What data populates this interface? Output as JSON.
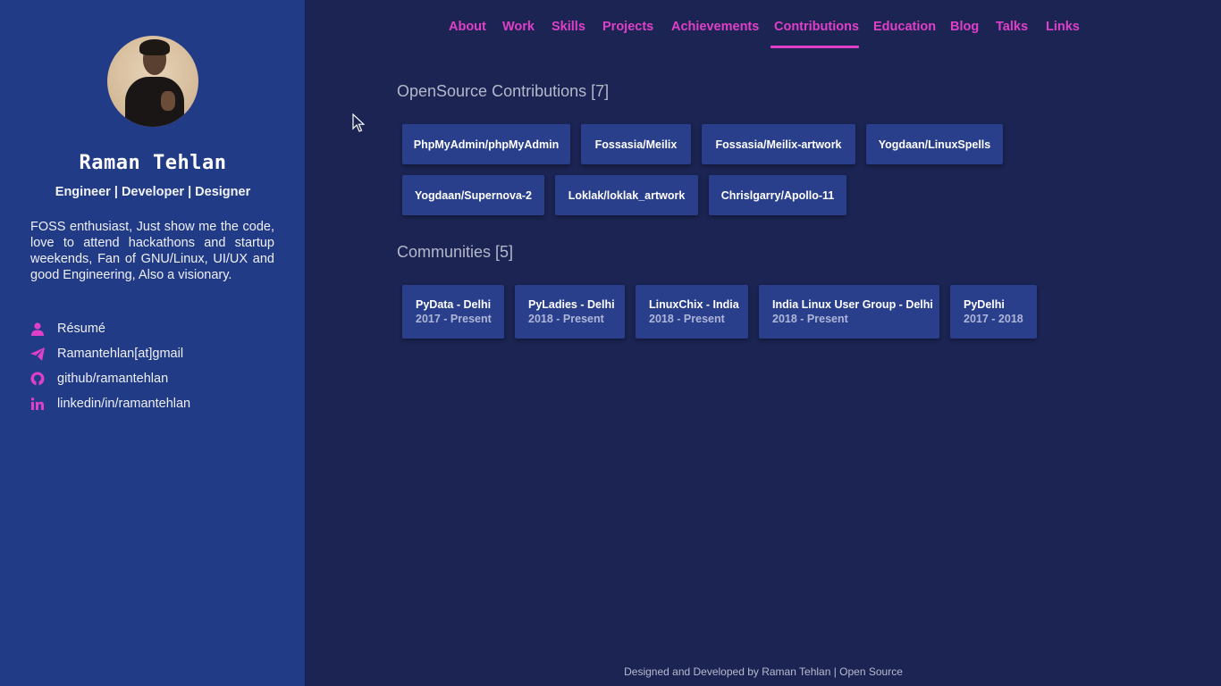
{
  "profile": {
    "name": "Raman Tehlan",
    "tagline": "Engineer | Developer | Designer",
    "bio": "FOSS enthusiast, Just show me the code, love to attend hackathons and startup weekends, Fan of GNU/Linux, UI/UX and good Engineering, Also a visionary.",
    "links": [
      {
        "icon": "user-icon",
        "label": "Résumé"
      },
      {
        "icon": "paper-plane-icon",
        "label": "Ramantehlan[at]gmail"
      },
      {
        "icon": "github-icon",
        "label": "github/ramantehlan"
      },
      {
        "icon": "linkedin-icon",
        "label": "linkedin/in/ramantehlan"
      }
    ]
  },
  "nav": {
    "items": [
      "About",
      "Work",
      "Skills",
      "Projects",
      "Achievements",
      "Contributions",
      "Education",
      "Blog",
      "Talks",
      "Links"
    ],
    "active": "Contributions"
  },
  "contributions": {
    "title": "OpenSource Contributions [7]",
    "items": [
      "PhpMyAdmin/phpMyAdmin",
      "Fossasia/Meilix",
      "Fossasia/Meilix-artwork",
      "Yogdaan/LinuxSpells",
      "Yogdaan/Supernova-2",
      "Loklak/loklak_artwork",
      "Chrislgarry/Apollo-11"
    ]
  },
  "communities": {
    "title": "Communities [5]",
    "items": [
      {
        "name": "PyData - Delhi",
        "dates": "2017 - Present"
      },
      {
        "name": "PyLadies - Delhi",
        "dates": "2018 - Present"
      },
      {
        "name": "LinuxChix - India",
        "dates": "2018 - Present"
      },
      {
        "name": "India Linux User Group - Delhi",
        "dates": "2018 - Present"
      },
      {
        "name": "PyDelhi",
        "dates": "2017 - 2018"
      }
    ]
  },
  "footer": "Designed and Developed by Raman Tehlan | Open Source",
  "colors": {
    "accent": "#e040c8",
    "sidebar": "#223b87",
    "background": "#1b2452",
    "card": "#2a3f8c"
  }
}
